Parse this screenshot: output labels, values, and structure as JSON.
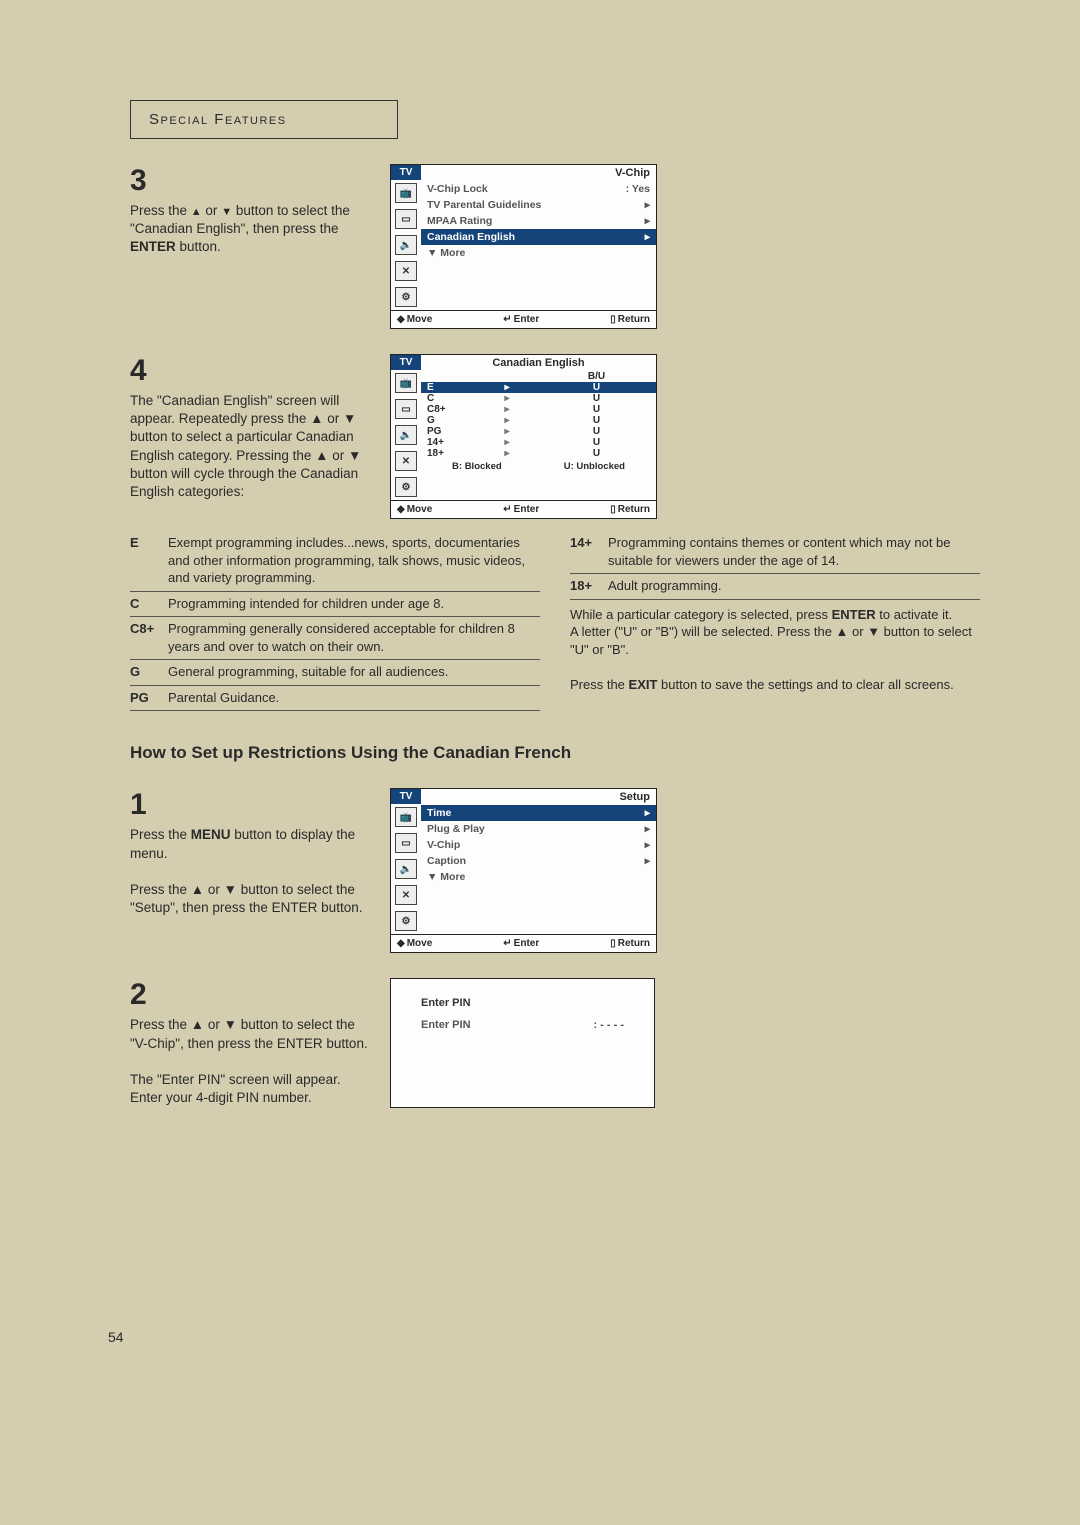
{
  "header": {
    "title": "Special Features"
  },
  "page_number": "54",
  "step3": {
    "num": "3",
    "text_before": "Press the ",
    "arrow_up": "▲",
    "text_mid1": " or ",
    "arrow_down": "▼",
    "text_mid2": " button to select the \"Canadian English\", then press the ",
    "bold": "ENTER",
    "text_after": " button.",
    "osd": {
      "tab": "TV",
      "title": "V-Chip",
      "rows": [
        {
          "label": "V-Chip Lock",
          "value": ": Yes",
          "hl": false
        },
        {
          "label": "TV Parental Guidelines",
          "value": "▸",
          "hl": false
        },
        {
          "label": "MPAA Rating",
          "value": "▸",
          "hl": false
        },
        {
          "label": "Canadian English",
          "value": "▸",
          "hl": true
        },
        {
          "label": "▼ More",
          "value": "",
          "hl": false
        }
      ],
      "footer": {
        "move": "Move",
        "enter": "Enter",
        "return": "Return"
      }
    }
  },
  "step4": {
    "num": "4",
    "text": "The \"Canadian English\" screen will appear. Repeatedly press the ▲ or ▼ button to select a particular Canadian English category.  Pressing the ▲ or ▼ button will cycle through the Canadian English categories:",
    "osd": {
      "tab": "TV",
      "title": "Canadian English",
      "header": "B/U",
      "rows": [
        {
          "k": "E",
          "m": "▸",
          "v": "U",
          "hl": true
        },
        {
          "k": "C",
          "m": "▸",
          "v": "U",
          "hl": false
        },
        {
          "k": "C8+",
          "m": "▸",
          "v": "U",
          "hl": false
        },
        {
          "k": "G",
          "m": "▸",
          "v": "U",
          "hl": false
        },
        {
          "k": "PG",
          "m": "▸",
          "v": "U",
          "hl": false
        },
        {
          "k": "14+",
          "m": "▸",
          "v": "U",
          "hl": false
        },
        {
          "k": "18+",
          "m": "▸",
          "v": "U",
          "hl": false
        }
      ],
      "legend": {
        "b": "B: Blocked",
        "u": "U: Unblocked"
      },
      "footer": {
        "move": "Move",
        "enter": "Enter",
        "return": "Return"
      }
    }
  },
  "defs_left": [
    {
      "k": "E",
      "v": "Exempt programming includes...news, sports, documentaries and other information programming, talk shows, music videos, and variety programming."
    },
    {
      "k": "C",
      "v": "Programming intended for children under age 8."
    },
    {
      "k": "C8+",
      "v": "Programming generally considered acceptable for children 8 years and over to watch on their own."
    },
    {
      "k": "G",
      "v": "General programming, suitable for all audiences."
    },
    {
      "k": "PG",
      "v": "Parental Guidance."
    }
  ],
  "defs_right": [
    {
      "k": "14+",
      "v": "Programming contains themes or content which may not be suitable for viewers under the age of 14."
    },
    {
      "k": "18+",
      "v": "Adult programming."
    }
  ],
  "defs_para": {
    "l1a": "While a particular category is selected, press ",
    "l1b": "ENTER",
    "l1c": " to activate it.",
    "l2": "A letter (\"U\" or \"B\") will be selected. Press the ▲ or ▼ button to select \"U\" or \"B\".",
    "l3a": "Press the ",
    "l3b": "EXIT",
    "l3c": " button to save the settings and to clear all screens."
  },
  "section2_title": "How to Set up Restrictions Using the Canadian French",
  "stepA": {
    "num": "1",
    "p1a": "Press the ",
    "p1b": "MENU",
    "p1c": " button to display the menu.",
    "p2": "Press the ▲ or ▼ button to select the \"Setup\", then press the ENTER button.",
    "osd": {
      "tab": "TV",
      "title": "Setup",
      "rows": [
        {
          "label": "Time",
          "value": "▸",
          "hl": true
        },
        {
          "label": "Plug & Play",
          "value": "▸",
          "hl": false
        },
        {
          "label": "V-Chip",
          "value": "▸",
          "hl": false
        },
        {
          "label": "Caption",
          "value": "▸",
          "hl": false
        },
        {
          "label": "▼ More",
          "value": "",
          "hl": false
        }
      ],
      "footer": {
        "move": "Move",
        "enter": "Enter",
        "return": "Return"
      }
    }
  },
  "stepB": {
    "num": "2",
    "p1": "Press the ▲ or ▼ button to select the \"V-Chip\", then press the ENTER button.",
    "p2": "The \"Enter PIN\" screen will appear. Enter your 4-digit PIN number.",
    "osd": {
      "title": "Enter PIN",
      "row_label": "Enter PIN",
      "row_value": ": - - - -"
    }
  }
}
